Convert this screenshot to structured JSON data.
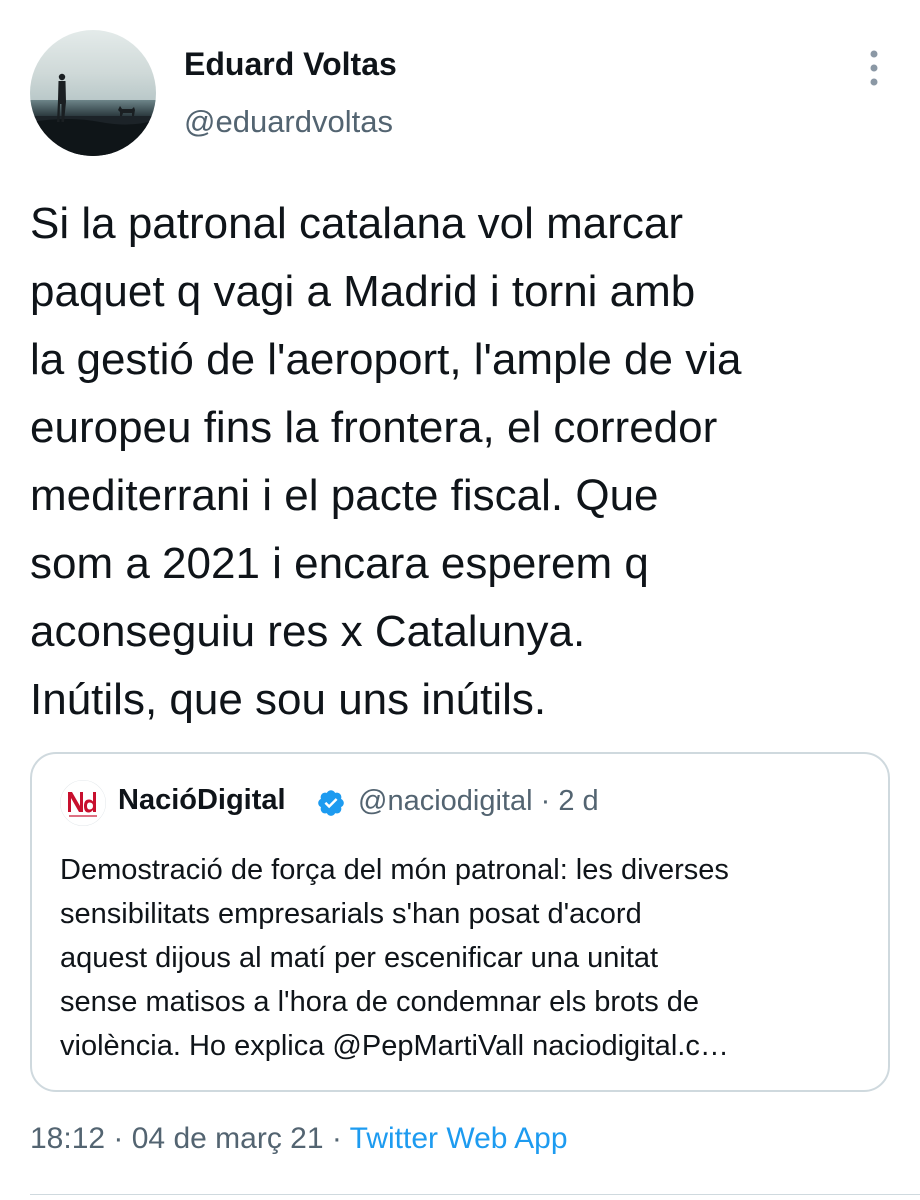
{
  "author": {
    "name": "Eduard Voltas",
    "handle": "@eduardvoltas"
  },
  "tweet": {
    "text": "Si la patronal catalana vol marcar\npaquet q vagi a Madrid i torni amb\nla gestió de l'aeroport, l'ample de via\neuropeu fins la frontera, el corredor\nmediterrani i el pacte fiscal. Que\nsom a 2021 i encara esperem q\naconseguiu res x Catalunya.\nInútils, que sou uns inútils."
  },
  "quoted": {
    "name": "NacióDigital",
    "handle": "@naciodigital",
    "separator": " · ",
    "age": "2 d",
    "text": "Demostració de força del món patronal: les diverses\nsensibilitats empresarials s'han posat d'acord\naquest dijous al matí per escenificar una unitat\nsense matisos a l'hora de condemnar els brots de\nviolència. Ho explica @PepMartiVall naciodigital.c…",
    "logo_icon": "naciodigital-logo",
    "verified_icon": "verified-badge-icon"
  },
  "footer": {
    "time": "18:12",
    "separator": " · ",
    "date": "04 de març 21",
    "app": "Twitter Web App"
  },
  "icons": {
    "more": "more-vertical-icon"
  },
  "colors": {
    "text": "#0f1419",
    "secondary": "#536471",
    "link": "#1d9bf0",
    "border": "#cfd9de",
    "verified": "#1d9bf0",
    "logo": "#c8102e"
  }
}
